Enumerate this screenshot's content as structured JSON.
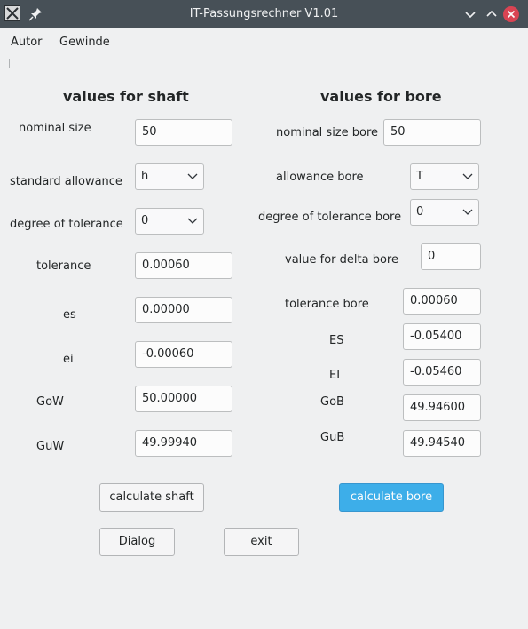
{
  "window": {
    "title": "IT-Passungsrechner V1.01"
  },
  "menu": {
    "items": [
      "Autor",
      "Gewinde"
    ]
  },
  "shaft": {
    "heading": "values for shaft",
    "nominal_size_label": "nominal size",
    "nominal_size_value": "50",
    "standard_allowance_label": "standard allowance",
    "standard_allowance_value": "h",
    "degree_label": "degree of tolerance",
    "degree_value": "0",
    "tolerance_label": "tolerance",
    "tolerance_value": "0.00060",
    "es_label": "es",
    "es_value": "0.00000",
    "ei_label": "ei",
    "ei_value": "-0.00060",
    "gow_label": "GoW",
    "gow_value": "50.00000",
    "guw_label": "GuW",
    "guw_value": "49.99940",
    "calculate_label": "calculate shaft"
  },
  "bore": {
    "heading": "values for bore",
    "nominal_size_label": "nominal size bore",
    "nominal_size_value": "50",
    "allowance_label": "allowance bore",
    "allowance_value": "T",
    "degree_label": "degree of tolerance bore",
    "degree_value": "0",
    "delta_label": "value for delta bore",
    "delta_value": "0",
    "tolerance_label": "tolerance bore",
    "tolerance_value": "0.00060",
    "es_label": "ES",
    "es_value": "-0.05400",
    "ei_label": "EI",
    "ei_value": "-0.05460",
    "gob_label": "GoB",
    "gob_value": "49.94600",
    "gub_label": "GuB",
    "gub_value": "49.94540",
    "calculate_label": "calculate bore"
  },
  "buttons": {
    "dialog_label": "Dialog",
    "exit_label": "exit"
  },
  "icons": {
    "app": "app-icon",
    "pin": "pin-icon",
    "minimize": "chevron-down-icon",
    "maximize": "chevron-up-icon",
    "close": "close-icon"
  },
  "colors": {
    "titlebar": "#475057",
    "accent": "#3daee9",
    "close": "#da4453",
    "background": "#eff0f1"
  }
}
